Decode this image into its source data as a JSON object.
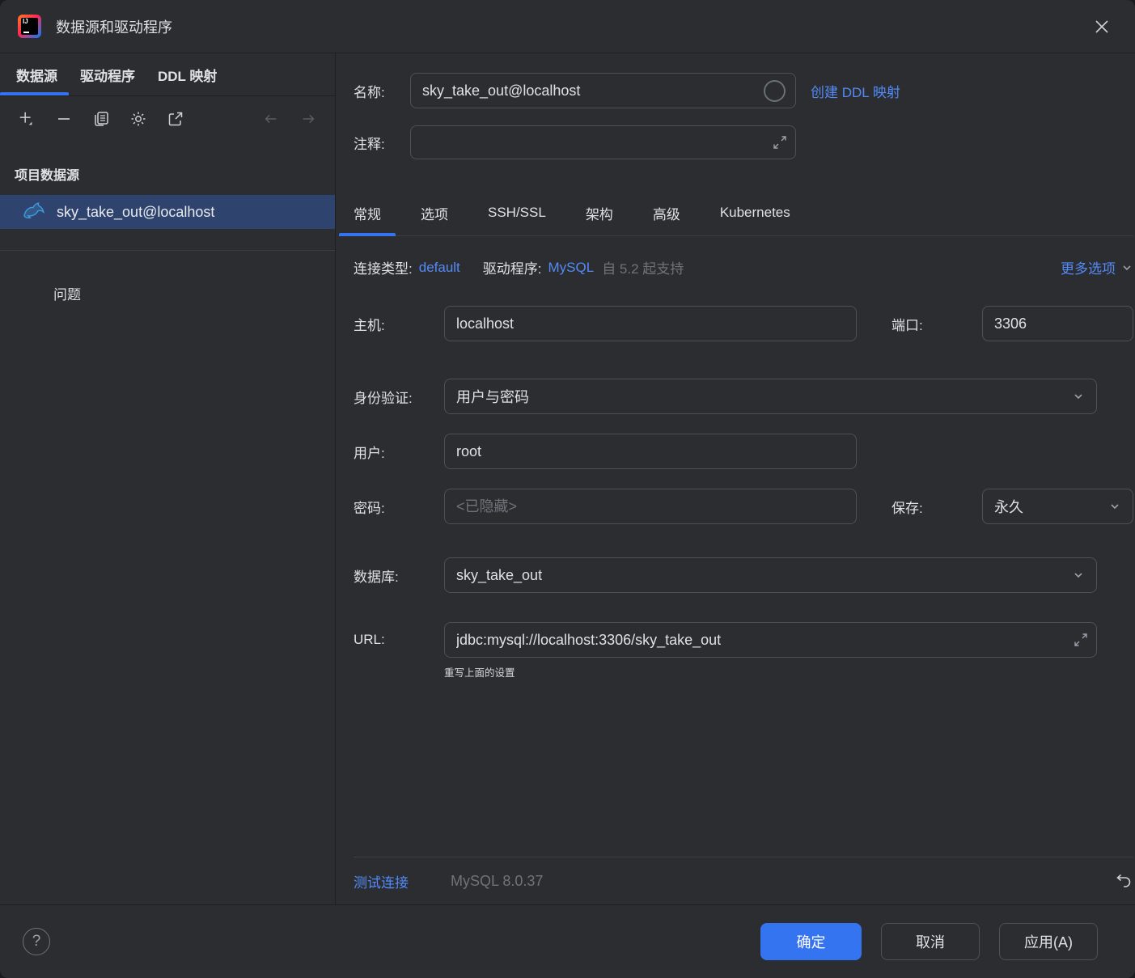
{
  "window": {
    "title": "数据源和驱动程序",
    "app_icon": "intellij-idea-logo"
  },
  "colors": {
    "accent_blue": "#3574F0",
    "link_blue": "#548AF7",
    "selection_bg": "#2E436E",
    "panel_bg": "#2B2D30",
    "border": "#4E5157",
    "muted_text": "#6F737A"
  },
  "left": {
    "tabs": [
      {
        "label": "数据源",
        "active": true
      },
      {
        "label": "驱动程序",
        "active": false
      },
      {
        "label": "DDL 映射",
        "active": false
      }
    ],
    "toolbar_icons": [
      "add-icon",
      "remove-icon",
      "duplicate-icon",
      "gear-icon",
      "open-in-new-icon",
      "back-arrow-icon",
      "forward-arrow-icon"
    ],
    "section_title": "项目数据源",
    "datasource": {
      "name": "sky_take_out@localhost",
      "icon": "mysql-dolphin-icon",
      "selected": true
    },
    "problems_label": "问题"
  },
  "right": {
    "name_label": "名称:",
    "name_value": "sky_take_out@localhost",
    "ddl_link": "创建 DDL 映射",
    "comment_label": "注释:",
    "comment_value": "",
    "tabs": [
      "常规",
      "选项",
      "SSH/SSL",
      "架构",
      "高级",
      "Kubernetes"
    ],
    "active_tab": "常规",
    "conn_type_label": "连接类型:",
    "conn_type_value": "default",
    "driver_label": "驱动程序:",
    "driver_value": "MySQL",
    "driver_note": "自 5.2 起支持",
    "more_options_label": "更多选项",
    "form": {
      "host_label": "主机:",
      "host_value": "localhost",
      "port_label": "端口:",
      "port_value": "3306",
      "auth_label": "身份验证:",
      "auth_value": "用户与密码",
      "user_label": "用户:",
      "user_value": "root",
      "password_label": "密码:",
      "password_placeholder": "<已隐藏>",
      "save_label": "保存:",
      "save_value": "永久",
      "database_label": "数据库:",
      "database_value": "sky_take_out",
      "url_label": "URL:",
      "url_value": "jdbc:mysql://localhost:3306/sky_take_out",
      "url_hint": "重写上面的设置"
    },
    "test_connection_label": "测试连接",
    "driver_version": "MySQL 8.0.37"
  },
  "footer": {
    "ok_label": "确定",
    "cancel_label": "取消",
    "apply_label": "应用(A)"
  }
}
